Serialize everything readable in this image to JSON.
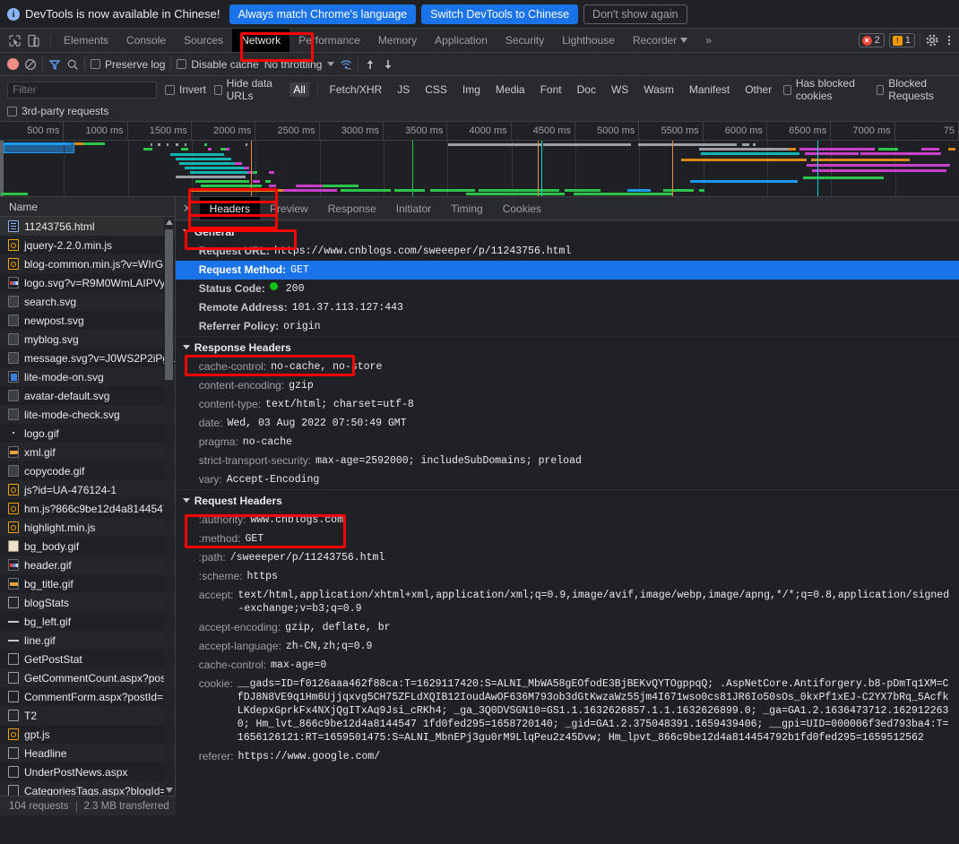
{
  "infobar": {
    "icon": "info-icon",
    "message": "DevTools is now available in Chinese!",
    "btn_primary": "Always match Chrome's language",
    "btn_secondary": "Switch DevTools to Chinese",
    "btn_dismiss": "Don't show again"
  },
  "tabbar": {
    "tabs": [
      {
        "label": "Elements",
        "active": false
      },
      {
        "label": "Console",
        "active": false
      },
      {
        "label": "Sources",
        "active": false
      },
      {
        "label": "Network",
        "active": true
      },
      {
        "label": "Performance",
        "active": false
      },
      {
        "label": "Memory",
        "active": false
      },
      {
        "label": "Application",
        "active": false
      },
      {
        "label": "Security",
        "active": false
      },
      {
        "label": "Lighthouse",
        "active": false
      },
      {
        "label": "Recorder",
        "active": false
      }
    ],
    "more": "»",
    "error_count": "2",
    "warning_count": "1",
    "error_glyph": "✕",
    "warning_glyph": "!",
    "settings_icon": "gear-icon",
    "menu_icon": "more-vertical-icon"
  },
  "nettoolbar": {
    "record_icon": "record-icon",
    "clear_icon": "clear-icon",
    "filter_icon": "funnel-icon",
    "search_icon": "search-icon",
    "preserve_log": "Preserve log",
    "disable_cache": "Disable cache",
    "throttling": "No throttling",
    "wifi_icon": "network-conditions-icon",
    "import_icon": "import-har-icon",
    "export_icon": "export-har-icon"
  },
  "filterbar": {
    "placeholder": "Filter",
    "value": "",
    "invert": "Invert",
    "hide_data_urls": "Hide data URLs",
    "types": [
      "All",
      "Fetch/XHR",
      "JS",
      "CSS",
      "Img",
      "Media",
      "Font",
      "Doc",
      "WS",
      "Wasm",
      "Manifest",
      "Other"
    ],
    "selected_type": "All",
    "has_blocked_cookies": "Has blocked cookies",
    "blocked_requests": "Blocked Requests",
    "third_party": "3rd-party requests"
  },
  "timeline": {
    "ticks": [
      "500 ms",
      "1000 ms",
      "1500 ms",
      "2000 ms",
      "2500 ms",
      "3000 ms",
      "3500 ms",
      "4000 ms",
      "4500 ms",
      "5000 ms",
      "5500 ms",
      "6000 ms",
      "6500 ms",
      "7000 ms",
      "75"
    ]
  },
  "sidebar": {
    "header": "Name",
    "requests": [
      {
        "name": "11243756.html",
        "icon": "doc",
        "selected": true
      },
      {
        "name": "jquery-2.2.0.min.js",
        "icon": "js"
      },
      {
        "name": "blog-common.min.js?v=WIrG",
        "icon": "js"
      },
      {
        "name": "logo.svg?v=R9M0WmLAIPVy.",
        "icon": "sw-logo"
      },
      {
        "name": "search.svg",
        "icon": "img"
      },
      {
        "name": "newpost.svg",
        "icon": "img"
      },
      {
        "name": "myblog.svg",
        "icon": "img"
      },
      {
        "name": "message.svg?v=J0WS2P2iPga",
        "icon": "img"
      },
      {
        "name": "lite-mode-on.svg",
        "icon": "sw-blue"
      },
      {
        "name": "avatar-default.svg",
        "icon": "img"
      },
      {
        "name": "lite-mode-check.svg",
        "icon": "img"
      },
      {
        "name": "logo.gif",
        "icon": "dot"
      },
      {
        "name": "xml.gif",
        "icon": "sw-orange"
      },
      {
        "name": "copycode.gif",
        "icon": "img"
      },
      {
        "name": "js?id=UA-476124-1",
        "icon": "js"
      },
      {
        "name": "hm.js?866c9be12d4a8144547",
        "icon": "js"
      },
      {
        "name": "highlight.min.js",
        "icon": "js"
      },
      {
        "name": "bg_body.gif",
        "icon": "sw-beige"
      },
      {
        "name": "header.gif",
        "icon": "sw-logo"
      },
      {
        "name": "bg_title.gif",
        "icon": "sw-orange"
      },
      {
        "name": "blogStats",
        "icon": "plain"
      },
      {
        "name": "bg_left.gif",
        "icon": "dash"
      },
      {
        "name": "line.gif",
        "icon": "dash"
      },
      {
        "name": "GetPostStat",
        "icon": "plain"
      },
      {
        "name": "GetCommentCount.aspx?pos",
        "icon": "plain"
      },
      {
        "name": "CommentForm.aspx?postId=.",
        "icon": "plain"
      },
      {
        "name": "T2",
        "icon": "plain"
      },
      {
        "name": "gpt.js",
        "icon": "js"
      },
      {
        "name": "Headline",
        "icon": "plain"
      },
      {
        "name": "UnderPostNews.aspx",
        "icon": "plain"
      },
      {
        "name": "CategoriesTags.aspx?blogId=",
        "icon": "plain"
      }
    ],
    "status": {
      "requests": "104 requests",
      "transferred": "2.3 MB transferred"
    }
  },
  "detail": {
    "close_icon": "close-icon",
    "tabs": [
      {
        "label": "Headers",
        "active": true
      },
      {
        "label": "Preview",
        "active": false
      },
      {
        "label": "Response",
        "active": false
      },
      {
        "label": "Initiator",
        "active": false
      },
      {
        "label": "Timing",
        "active": false
      },
      {
        "label": "Cookies",
        "active": false
      }
    ],
    "sections": [
      {
        "title": "General",
        "rows": [
          {
            "name": "Request URL:",
            "value": "https://www.cnblogs.com/sweeeper/p/11243756.html",
            "bold_name": true
          },
          {
            "name": "Request Method:",
            "value": "GET",
            "bold_name": true,
            "highlighted": true
          },
          {
            "name": "Status Code:",
            "value": "200",
            "bold_name": true,
            "status_dot": true
          },
          {
            "name": "Remote Address:",
            "value": "101.37.113.127:443",
            "bold_name": true
          },
          {
            "name": "Referrer Policy:",
            "value": "origin",
            "bold_name": true
          }
        ]
      },
      {
        "title": "Response Headers",
        "rows": [
          {
            "name": "cache-control:",
            "value": "no-cache, no-store"
          },
          {
            "name": "content-encoding:",
            "value": "gzip"
          },
          {
            "name": "content-type:",
            "value": "text/html; charset=utf-8"
          },
          {
            "name": "date:",
            "value": "Wed, 03 Aug 2022 07:50:49 GMT"
          },
          {
            "name": "pragma:",
            "value": "no-cache"
          },
          {
            "name": "strict-transport-security:",
            "value": "max-age=2592000; includeSubDomains; preload"
          },
          {
            "name": "vary:",
            "value": "Accept-Encoding"
          }
        ]
      },
      {
        "title": "Request Headers",
        "rows": [
          {
            "name": ":authority:",
            "value": "www.cnblogs.com"
          },
          {
            "name": ":method:",
            "value": "GET"
          },
          {
            "name": ":path:",
            "value": "/sweeeper/p/11243756.html"
          },
          {
            "name": ":scheme:",
            "value": "https"
          },
          {
            "name": "accept:",
            "value": "text/html,application/xhtml+xml,application/xml;q=0.9,image/avif,image/webp,image/apng,*/*;q=0.8,application/signed-exchange;v=b3;q=0.9",
            "wrap": true
          },
          {
            "name": "accept-encoding:",
            "value": "gzip, deflate, br"
          },
          {
            "name": "accept-language:",
            "value": "zh-CN,zh;q=0.9"
          },
          {
            "name": "cache-control:",
            "value": "max-age=0"
          },
          {
            "name": "cookie:",
            "value": "__gads=ID=f0126aaa462f88ca:T=1629117420:S=ALNI_MbWA58gEOfodE3BjBEKvQYTOgppqQ; .AspNetCore.Antiforgery.b8-pDmTq1XM=CfDJ8N8VE9q1Hm6Ujjqxvg5CH75ZFLdXQIB12IoudAwOF636M793ob3dGtKwzaWz55jm4I671wso0cs81JR6Io50sOs_0kxPf1xEJ-C2YX7bRq_5AcfkLKdepxGprkFx4NXjQgITxAq9Jsi_cRKh4; _ga_3Q0DVSGN10=GS1.1.1632626857.1.1.1632626899.0; _ga=GA1.2.1636473712.1629122630; Hm_lvt_866c9be12d4a8144547 1fd0fed295=1658720140; _gid=GA1.2.375048391.1659439406; __gpi=UID=000006f3ed793ba4:T=1656126121:RT=1659501475:S=ALNI_MbnEPj3gu0rM9LlqPeu2z45Dvw; Hm_lpvt_866c9be12d4a814454792b1fd0fed295=1659512562",
            "wrap": true
          },
          {
            "name": "referer:",
            "value": "https://www.google.com/"
          }
        ]
      }
    ]
  },
  "annotations": {
    "boxes": [
      "network-tab-highlight",
      "headers-tab-highlight",
      "general-section-highlight",
      "response-headers-highlight",
      "request-headers-highlight",
      "waterfall-region-highlight"
    ]
  },
  "colors": {
    "accent": "#1a73e8",
    "annotation": "#ff0000",
    "background": "#202124",
    "panel": "#292a2d",
    "text": "#e8eaed",
    "muted": "#9aa0a6",
    "status_ok": "#14c414"
  }
}
